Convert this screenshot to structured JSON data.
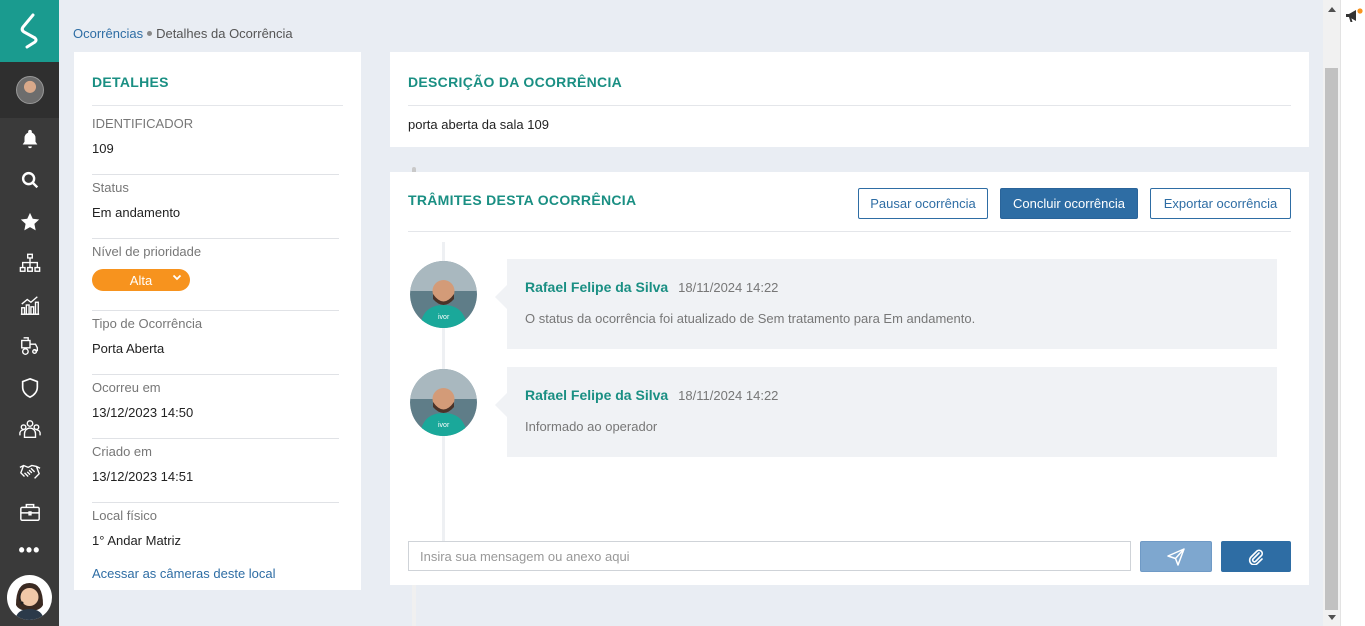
{
  "breadcrumb": {
    "parent": "Ocorrências",
    "current": "Detalhes da Ocorrência"
  },
  "details": {
    "title": "DETALHES",
    "identifier_label": "IDENTIFICADOR",
    "identifier_value": "109",
    "status_label": "Status",
    "status_value": "Em andamento",
    "priority_label": "Nível de prioridade",
    "priority_value": "Alta",
    "type_label": "Tipo de Ocorrência",
    "type_value": "Porta Aberta",
    "occurred_label": "Ocorreu em",
    "occurred_value": "13/12/2023 14:50",
    "created_label": "Criado em",
    "created_value": "13/12/2023 14:51",
    "location_label": "Local físico",
    "location_value": "1° Andar Matriz",
    "cameras_link": "Acessar as câmeras deste local"
  },
  "description": {
    "title": "DESCRIÇÃO DA OCORRÊNCIA",
    "text": "porta aberta da sala 109"
  },
  "tramites": {
    "title": "TRÂMITES DESTA OCORRÊNCIA",
    "pause_label": "Pausar ocorrência",
    "conclude_label": "Concluir ocorrência",
    "export_label": "Exportar ocorrência",
    "entries": [
      {
        "author": "Rafael Felipe da Silva",
        "time": "18/11/2024 14:22",
        "message": "O status da ocorrência foi atualizado de Sem tratamento para Em andamento."
      },
      {
        "author": "Rafael Felipe da Silva",
        "time": "18/11/2024 14:22",
        "message": "Informado ao operador"
      }
    ],
    "input_placeholder": "Insira sua mensagem ou anexo aqui"
  },
  "colors": {
    "accent": "#1a8f83",
    "primary_button": "#2e6da4",
    "priority": "#f7931e",
    "sidebar": "#3a3a3a"
  },
  "sidebar_icons": [
    "bell-icon",
    "search-icon",
    "star-icon",
    "org-chart-icon",
    "chart-icon",
    "tractor-icon",
    "shield-icon",
    "team-icon",
    "handshake-icon",
    "briefcase-icon"
  ]
}
